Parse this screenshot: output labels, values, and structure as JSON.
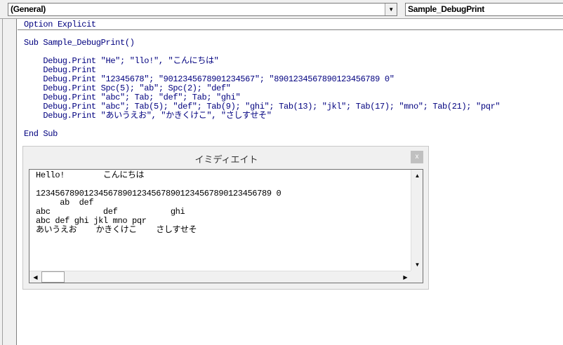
{
  "toolbar": {
    "object_combo": "(General)",
    "procedure_combo": "Sample_DebugPrint",
    "dropdown_glyph": "▼"
  },
  "code": {
    "lines": [
      "Option Explicit",
      "Sub Sample_DebugPrint()",
      "    Debug.Print \"He\"; \"llo!\", \"こんにちは\"",
      "    Debug.Print",
      "    Debug.Print \"12345678\"; \"9012345678901234567\"; \"8901234567890123456789 0\"",
      "    Debug.Print Spc(5); \"ab\"; Spc(2); \"def\"",
      "    Debug.Print \"abc\"; Tab; \"def\"; Tab; \"ghi\"",
      "    Debug.Print \"abc\"; Tab(5); \"def\"; Tab(9); \"ghi\"; Tab(13); \"jkl\"; Tab(17); \"mno\"; Tab(21); \"pqr\"",
      "    Debug.Print \"あいうえお\", \"かきくけこ\", \"さしすせそ\"",
      "End Sub"
    ]
  },
  "immediate": {
    "title": "イミディエイト",
    "close": "x",
    "output": [
      "Hello!        こんにちは",
      "1234567890123456789012345678901234567890123456789 0",
      "     ab  def",
      "abc           def           ghi",
      "abc def ghi jkl mno pqr",
      "あいうえお    かきくけこ    さしすせそ"
    ],
    "scroll": {
      "up": "▲",
      "down": "▼",
      "left": "◀",
      "right": "▶"
    }
  }
}
